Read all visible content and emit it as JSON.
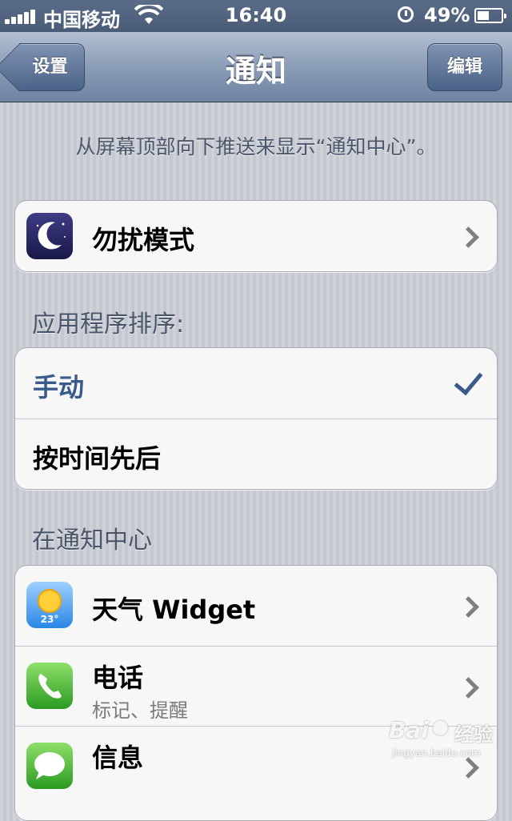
{
  "status_bar": {
    "carrier": "中国移动",
    "time": "16:40",
    "battery": "49%",
    "battery_level": 0.49
  },
  "nav_bar": {
    "back_label": "设置",
    "title": "通知",
    "edit_label": "编辑"
  },
  "hint": "从屏幕顶部向下推送来显示“通知中心”。",
  "dnd": {
    "label": "勿扰模式"
  },
  "sort": {
    "header": "应用程序排序:",
    "options": [
      {
        "label": "手动",
        "selected": true
      },
      {
        "label": "按时间先后",
        "selected": false
      }
    ]
  },
  "notification_center": {
    "header": "在通知中心",
    "apps": [
      {
        "name": "天气 Widget",
        "icon": "weather-icon",
        "temp": "23°"
      },
      {
        "name": "电话",
        "subtitle": "标记、提醒",
        "icon": "phone-icon"
      },
      {
        "name": "信息",
        "icon": "message-icon"
      }
    ]
  },
  "watermark": {
    "brand": "Bai",
    "cn": "经验",
    "url": "jingyan.baidu.com"
  },
  "colors": {
    "nav_bar": "#8b9cb6",
    "selected_text": "#3a5a8c",
    "background": "#c9ccd4"
  }
}
